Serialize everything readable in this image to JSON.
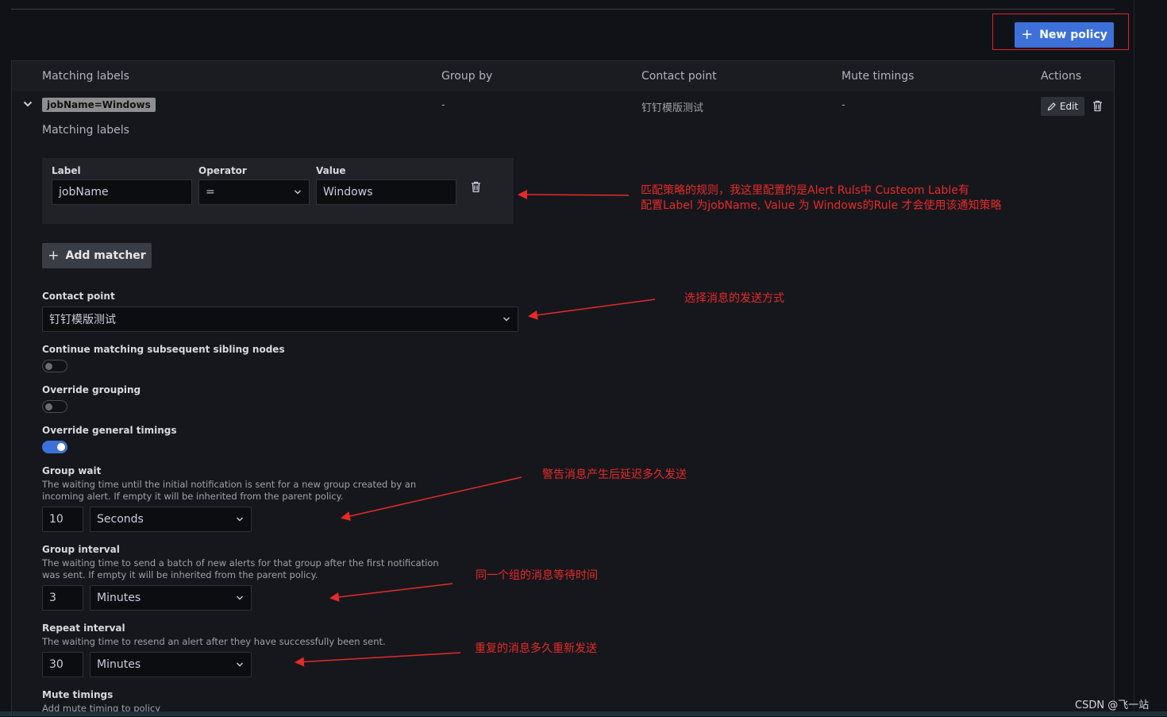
{
  "toolbar": {
    "new_policy_label": "New policy"
  },
  "table": {
    "headers": [
      "Matching labels",
      "Group by",
      "Contact point",
      "Mute timings",
      "Actions"
    ],
    "row": {
      "label_chip": "jobName=Windows",
      "group_by": "-",
      "contact_point": "钉钉模版测试",
      "mute_timings": "-",
      "edit_label": "Edit"
    }
  },
  "editor": {
    "matching_labels_title": "Matching labels",
    "matcher": {
      "label_heading": "Label",
      "operator_heading": "Operator",
      "value_heading": "Value",
      "label_value": "jobName",
      "operator_value": "=",
      "value_value": "Windows"
    },
    "add_matcher_label": "Add matcher",
    "contact_point": {
      "label": "Contact point",
      "value": "钉钉模版测试"
    },
    "continue_matching": {
      "label": "Continue matching subsequent sibling nodes",
      "enabled": false
    },
    "override_grouping": {
      "label": "Override grouping",
      "enabled": false
    },
    "override_timings": {
      "label": "Override general timings",
      "enabled": true
    },
    "group_wait": {
      "label": "Group wait",
      "desc_line1": "The waiting time until the initial notification is sent for a new group created by an",
      "desc_line2": "incoming alert. If empty it will be inherited from the parent policy.",
      "value": "10",
      "unit": "Seconds"
    },
    "group_interval": {
      "label": "Group interval",
      "desc_line1": "The waiting time to send a batch of new alerts for that group after the first notification",
      "desc_line2": "was sent. If empty it will be inherited from the parent policy.",
      "value": "3",
      "unit": "Minutes"
    },
    "repeat_interval": {
      "label": "Repeat interval",
      "desc_line1": "The waiting time to resend an alert after they have successfully been sent.",
      "value": "30",
      "unit": "Minutes"
    },
    "mute_timings": {
      "label": "Mute timings",
      "desc_line1": "Add mute timing to policy"
    }
  },
  "annotations": {
    "matcher_line1": "匹配策略的规则，我这里配置的是Alert Ruls中 Custeom Lable有",
    "matcher_line2": "配置Label 为jobName, Value 为 Windows的Rule 才会使用该通知策略",
    "contact_point": "选择消息的发送方式",
    "group_wait": "警告消息产生后延迟多久发送",
    "group_interval": "同一个组的消息等待时间",
    "repeat_interval": "重复的消息多久重新发送"
  },
  "watermark": "CSDN @飞一站",
  "colors": {
    "primary": "#3d71d9",
    "annotation": "#e62a2a",
    "background": "#111217"
  }
}
